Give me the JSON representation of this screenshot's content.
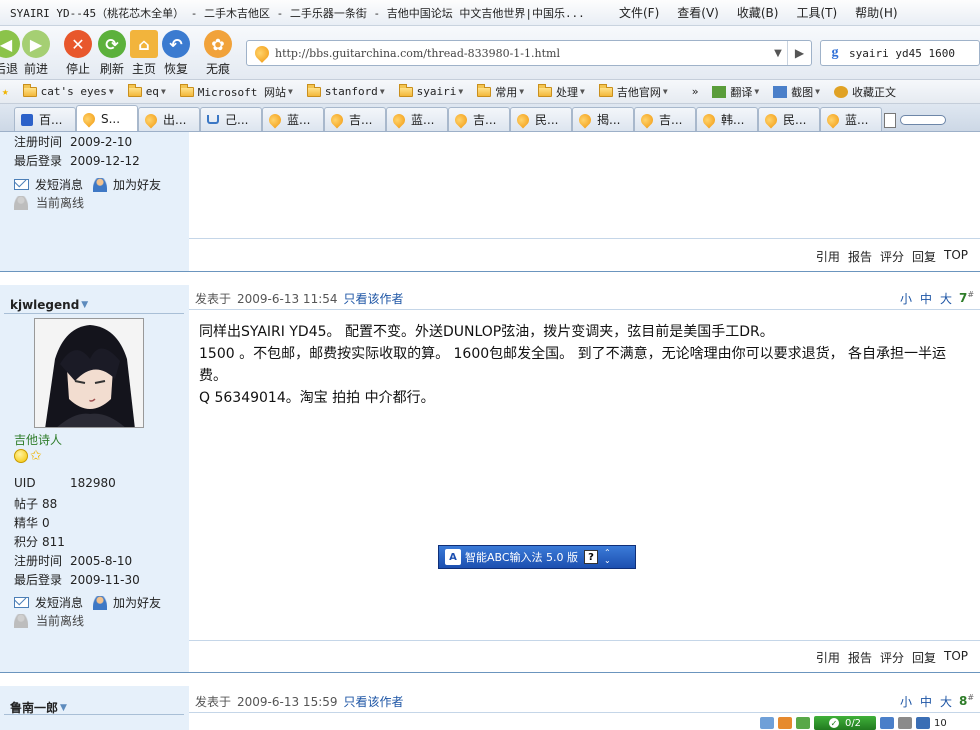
{
  "window": {
    "title": "SYAIRI YD--45（桃花芯木全单） - 二手木吉他区 - 二手乐器一条街 - 吉他中国论坛 中文吉他世界|中国乐...",
    "menu": [
      "文件(F)",
      "查看(V)",
      "收藏(B)",
      "工具(T)",
      "帮助(H)"
    ]
  },
  "toolbar": {
    "back": "后退",
    "forward": "前进",
    "stop": "停止",
    "refresh": "刷新",
    "home": "主页",
    "restore": "恢复",
    "notrace": "无痕",
    "url": "http://bbs.guitarchina.com/thread-833980-1-1.html",
    "search_value": "syairi yd45 1600"
  },
  "bookmarks": [
    "cat's eyes",
    "eq",
    "Microsoft 网站",
    "stanford",
    "syairi",
    "常用",
    "处理",
    "吉他官网"
  ],
  "bookmarks_right": [
    "翻译",
    "截图",
    "收藏正文"
  ],
  "bookmarks_more": "»",
  "tabs": [
    {
      "label": "百...",
      "icon": "baidu"
    },
    {
      "label": "S...",
      "icon": "fav",
      "active": true
    },
    {
      "label": "出...",
      "icon": "fav"
    },
    {
      "label": "己...",
      "icon": "cart"
    },
    {
      "label": "蓝...",
      "icon": "fav"
    },
    {
      "label": "吉...",
      "icon": "fav"
    },
    {
      "label": "蓝...",
      "icon": "fav"
    },
    {
      "label": "吉...",
      "icon": "fav"
    },
    {
      "label": "民...",
      "icon": "fav"
    },
    {
      "label": "揭...",
      "icon": "fav"
    },
    {
      "label": "吉...",
      "icon": "fav"
    },
    {
      "label": "韩...",
      "icon": "fav"
    },
    {
      "label": "民...",
      "icon": "fav"
    },
    {
      "label": "蓝...",
      "icon": "fav"
    }
  ],
  "prev_post": {
    "reg_label": "注册时间",
    "reg_value": "2009-2-10",
    "last_label": "最后登录",
    "last_value": "2009-12-12",
    "send_msg": "发短消息",
    "add_friend": "加为好友",
    "offline": "当前离线"
  },
  "post_actions": [
    "引用",
    "报告",
    "评分",
    "回复",
    "TOP"
  ],
  "post7": {
    "username": "kjwlegend",
    "rank": "吉他诗人",
    "posted_label": "发表于",
    "posted_time": "2009-6-13 11:54",
    "only_author": "只看该作者",
    "font_sizes": [
      "小",
      "中",
      "大"
    ],
    "floor": "7",
    "floor_sup": "#",
    "lines": [
      "同样出SYAIRI YD45。 配置不变。外送DUNLOP弦油，拨片变调夹，弦目前是美国手工DR。",
      "1500 。不包邮，邮费按实际收取的算。 1600包邮发全国。 到了不满意，无论啥理由你可以要求退货， 各自承担一半运费。",
      "Q 56349014。淘宝 拍拍 中介都行。"
    ],
    "stats": [
      {
        "k": "UID",
        "v": "182980"
      },
      {
        "k": "帖子",
        "v": "88"
      },
      {
        "k": "精华",
        "v": "0"
      },
      {
        "k": "积分",
        "v": "811"
      },
      {
        "k": "注册时间",
        "v": "2005-8-10"
      },
      {
        "k": "最后登录",
        "v": "2009-11-30"
      }
    ],
    "send_msg": "发短消息",
    "add_friend": "加为好友",
    "offline": "当前离线"
  },
  "post8": {
    "username": "鲁南一郎",
    "posted_label": "发表于",
    "posted_time": "2009-6-13 15:59",
    "only_author": "只看该作者",
    "font_sizes": [
      "小",
      "中",
      "大"
    ],
    "floor": "8",
    "floor_sup": "#"
  },
  "ime": {
    "label": "智能ABC输入法 5.0 版",
    "help": "?"
  },
  "tray": {
    "counter": "0/2",
    "zoom": "10"
  },
  "colors": {
    "link": "#1d55a5",
    "sidebar": "#e6f0fa",
    "divider": "#6b95be",
    "rank": "#2f7d2a"
  }
}
